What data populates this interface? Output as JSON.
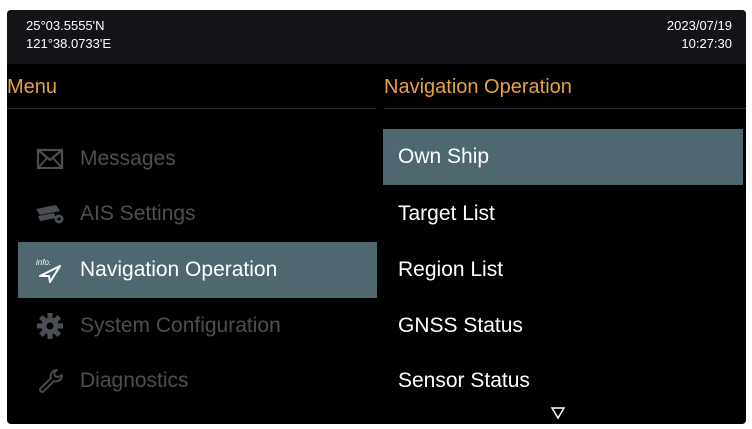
{
  "status": {
    "latitude": "25°03.5555'N",
    "longitude": "121°38.0733'E",
    "date": "2023/07/19",
    "time": "10:27:30"
  },
  "menu": {
    "title": "Menu",
    "items": [
      {
        "label": "Messages",
        "icon": "envelope-icon",
        "active": false
      },
      {
        "label": "AIS Settings",
        "icon": "ais-transponder-icon",
        "active": false
      },
      {
        "label": "Navigation Operation",
        "icon": "info-navigation-icon",
        "icon_text": "info.",
        "active": true
      },
      {
        "label": "System Configuration",
        "icon": "gear-icon",
        "active": false
      },
      {
        "label": "Diagnostics",
        "icon": "wrench-icon",
        "active": false
      }
    ]
  },
  "submenu": {
    "title": "Navigation Operation",
    "items": [
      {
        "label": "Own Ship",
        "active": true
      },
      {
        "label": "Target List",
        "active": false
      },
      {
        "label": "Region List",
        "active": false
      },
      {
        "label": "GNSS Status",
        "active": false
      },
      {
        "label": "Sensor Status",
        "active": false
      }
    ],
    "more_indicator": "scroll-down-arrow-icon"
  },
  "colors": {
    "background": "#000000",
    "status_bar": "#121417",
    "accent_header": "#e8a045",
    "selection": "#4f686f",
    "disabled_text": "#4b4f54",
    "text": "#ffffff"
  }
}
